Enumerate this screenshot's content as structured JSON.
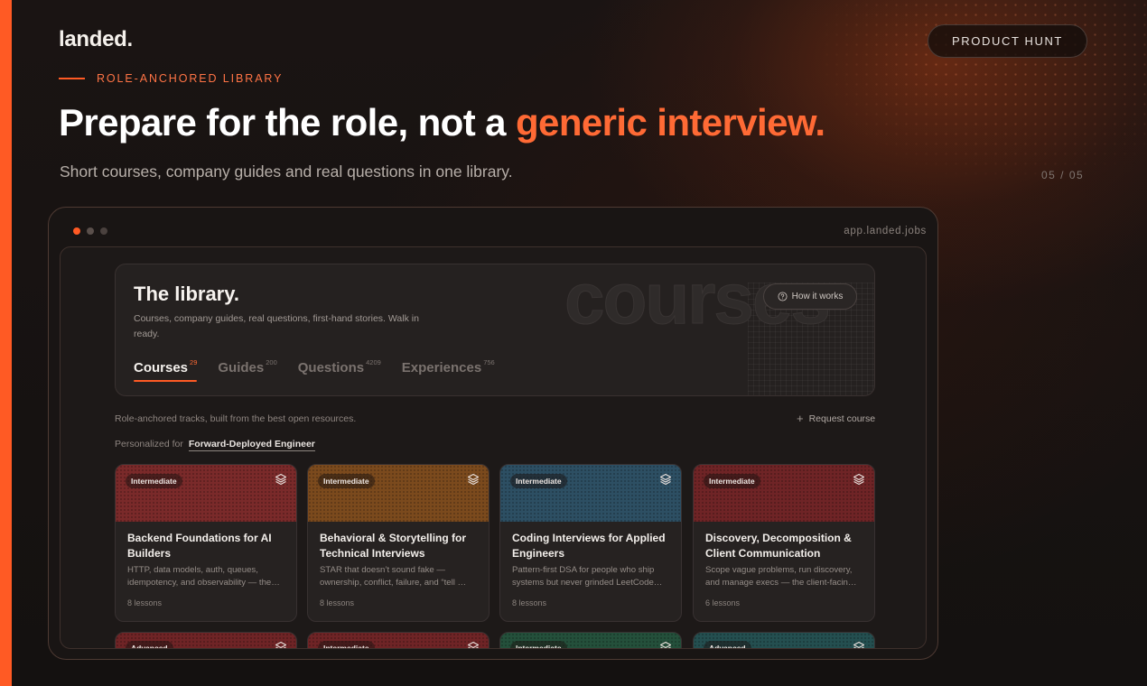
{
  "brand": {
    "logo": "landed.",
    "accent": "#ff5a24"
  },
  "header": {
    "cta_label": "PRODUCT HUNT",
    "eyebrow": "ROLE-ANCHORED LIBRARY",
    "headline_main": "Prepare for the role, not a",
    "headline_highlight": "generic interview.",
    "subline": "Short courses, company guides and real questions in one library.",
    "pager": "05 / 05"
  },
  "window": {
    "url": "app.landed.jobs"
  },
  "library": {
    "title": "The library.",
    "description": "Courses, company guides, real questions, first-hand stories. Walk in ready.",
    "watermark": "courses",
    "how_it_works": "How it works",
    "tabs": [
      {
        "label": "Courses",
        "count": "29"
      },
      {
        "label": "Guides",
        "count": "200"
      },
      {
        "label": "Questions",
        "count": "4209"
      },
      {
        "label": "Experiences",
        "count": "756"
      }
    ],
    "tracks_note": "Role-anchored tracks, built from the best open resources.",
    "request_label": "Request course",
    "personalized_label": "Personalized for",
    "personalized_role": "Forward-Deployed Engineer"
  },
  "courses": [
    {
      "level": "Intermediate",
      "title": "Backend Foundations for AI Builders",
      "desc": "HTTP, data models, auth, queues, idempotency, and observability — the…",
      "lessons": "8 lessons",
      "color": "#7a2a2a"
    },
    {
      "level": "Intermediate",
      "title": "Behavioral & Storytelling for Technical Interviews",
      "desc": "STAR that doesn’t sound fake — ownership, conflict, failure, and “tell …",
      "lessons": "8 lessons",
      "color": "#7b4a1d"
    },
    {
      "level": "Intermediate",
      "title": "Coding Interviews for Applied Engineers",
      "desc": "Pattern-first DSA for people who ship systems but never grinded LeetCode…",
      "lessons": "8 lessons",
      "color": "#2d4f63"
    },
    {
      "level": "Intermediate",
      "title": "Discovery, Decomposition & Client Communication",
      "desc": "Scope vague problems, run discovery, and manage execs — the client-facin…",
      "lessons": "6 lessons",
      "color": "#6f2426"
    }
  ],
  "next_row": [
    {
      "level": "Advanced",
      "color": "#6f2426"
    },
    {
      "level": "Intermediate",
      "color": "#6f2426"
    },
    {
      "level": "Intermediate",
      "color": "#24503b"
    },
    {
      "level": "Advanced",
      "color": "#244f50"
    }
  ]
}
